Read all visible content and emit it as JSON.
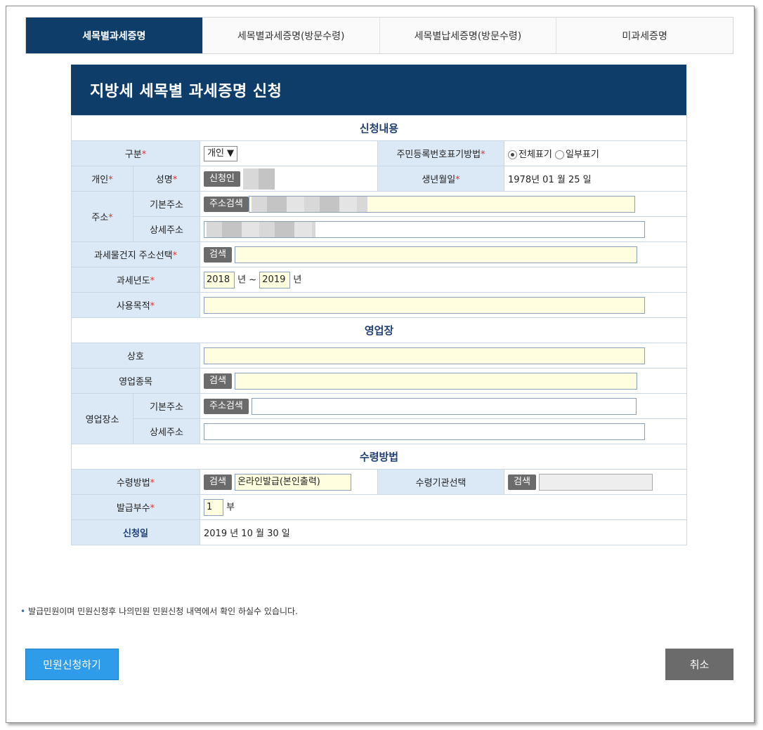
{
  "tabs": [
    "세목별과세증명",
    "세목별과세증명(방문수령)",
    "세목별납세증명(방문수령)",
    "미과세증명"
  ],
  "panel_title": "지방세 세목별 과세증명 신청",
  "sections": {
    "application": "신청내용",
    "business": "영업장",
    "receipt": "수령방법"
  },
  "required_mark": "*",
  "form": {
    "category_label": "구분",
    "category_value": "개인 ▼",
    "rrn_label": "주민등록번호표기방법",
    "rrn_opt_full": "전체표기",
    "rrn_opt_partial": "일부표기",
    "individual_label": "개인",
    "name_label": "성명",
    "applicant_btn": "신청인",
    "birth_label": "생년월일",
    "birth_value": "1978년 01 월 25 일",
    "address_label": "주소",
    "basic_addr_label": "기본주소",
    "addr_search_btn": "주소검색",
    "detail_addr_label": "상세주소",
    "tax_obj_label": "과세물건지 주소선택",
    "search_btn": "검색",
    "tax_year_label": "과세년도",
    "year_from": "2018",
    "year_sep": "년 ~",
    "year_to": "2019",
    "year_suffix": "년",
    "purpose_label": "사용목적"
  },
  "business": {
    "name_label": "상호",
    "type_label": "영업종목",
    "place_label": "영업장소",
    "basic_addr_label": "기본주소",
    "detail_addr_label": "상세주소"
  },
  "receipt": {
    "method_label": "수령방법",
    "method_value": "온라인발급(본인출력)",
    "agency_label": "수령기관선택",
    "copies_label": "발급부수",
    "copies_value": "1",
    "copies_unit": "부",
    "date_label": "신청일",
    "date_value": "2019  년 10  월 30  일"
  },
  "note": "발급민원이며 민원신청후 나의민원 민원신청 내역에서 확인 하실수 있습니다.",
  "buttons": {
    "submit": "민원신청하기",
    "cancel": "취소"
  }
}
